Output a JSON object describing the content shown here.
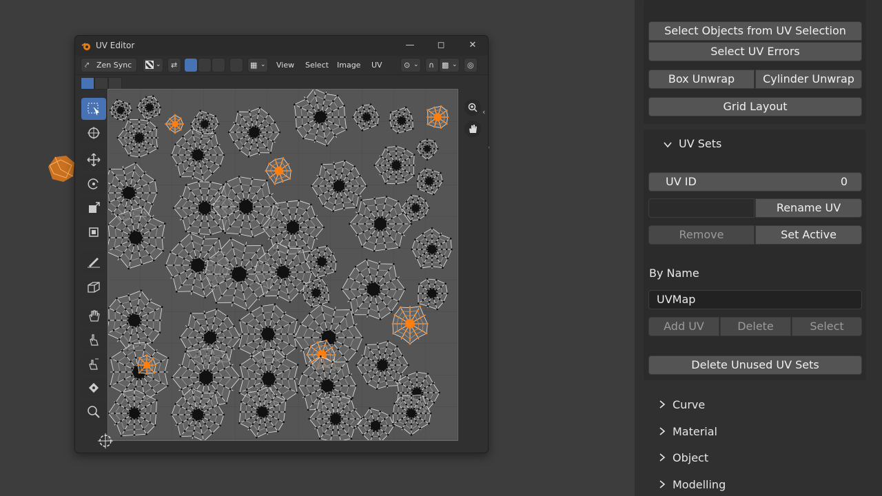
{
  "uv_editor": {
    "title": "UV Editor",
    "header": {
      "zen_sync_label": "Zen Sync",
      "menu_view": "View",
      "menu_select": "Select",
      "menu_image": "Image",
      "menu_uv": "UV"
    }
  },
  "panel": {
    "select_objects_from_uv": "Select Objects from UV Selection",
    "select_uv_errors": "Select UV Errors",
    "box_unwrap": "Box Unwrap",
    "cylinder_unwrap": "Cylinder Unwrap",
    "grid_layout": "Grid Layout",
    "uv_sets": {
      "title": "UV Sets",
      "uv_id_label": "UV ID",
      "uv_id_value": "0",
      "rename_uv": "Rename UV",
      "remove": "Remove",
      "set_active": "Set Active",
      "by_name_label": "By Name",
      "name_value": "UVMap",
      "add_uv": "Add UV",
      "delete": "Delete",
      "select": "Select",
      "delete_unused": "Delete Unused UV Sets"
    },
    "sections": [
      "Curve",
      "Material",
      "Object",
      "Modelling"
    ]
  },
  "colors": {
    "accent": "#4772b3",
    "selection": "#ff7f0e"
  }
}
